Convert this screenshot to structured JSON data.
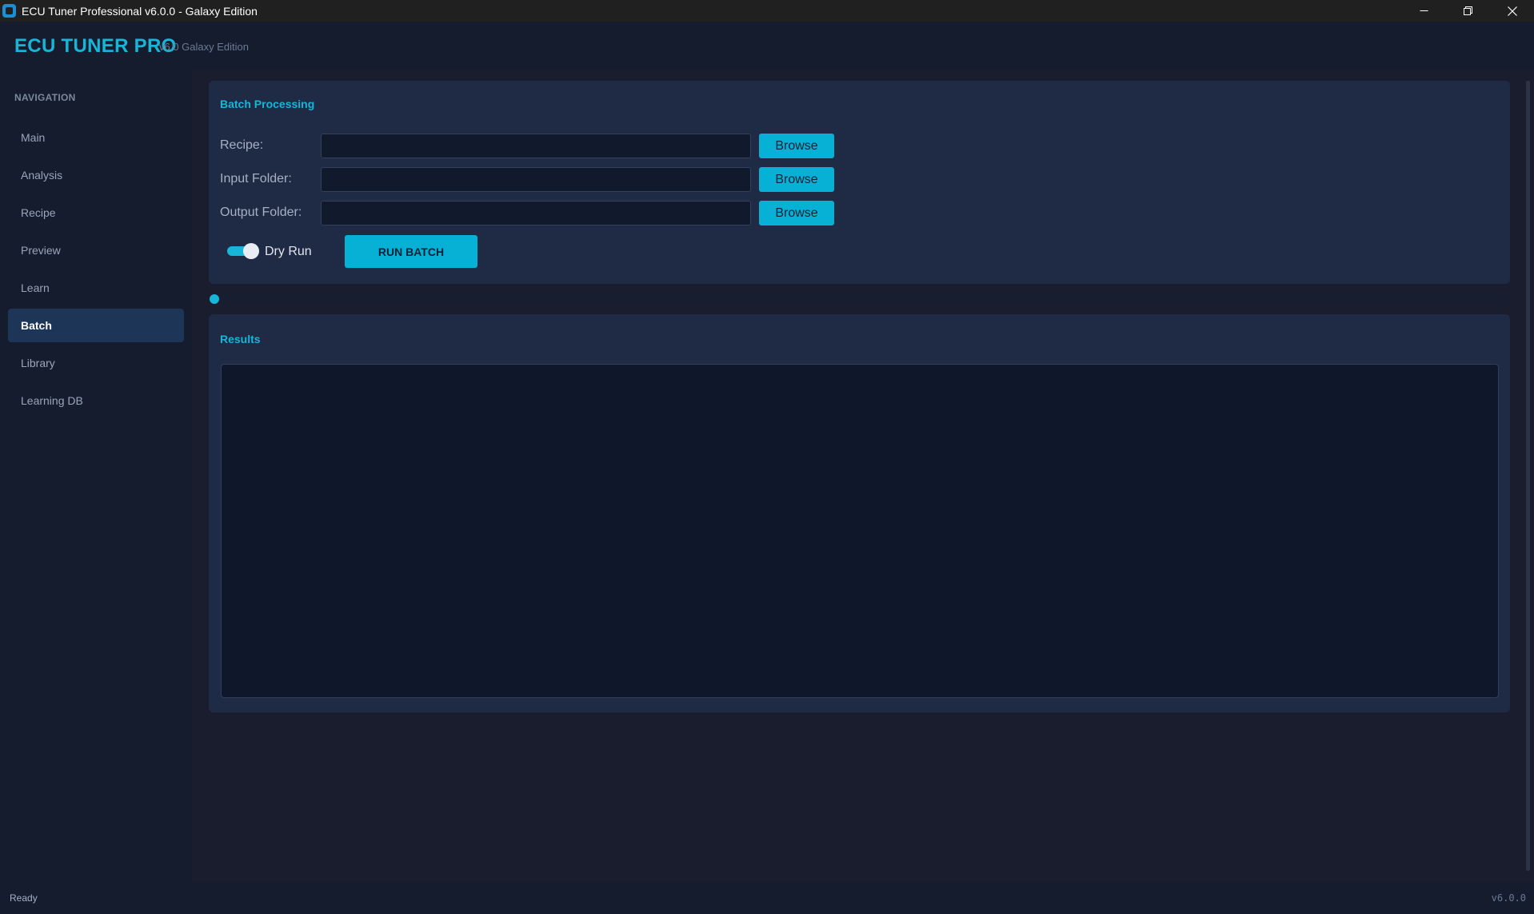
{
  "window": {
    "title": "ECU Tuner Professional v6.0.0 - Galaxy Edition",
    "minimize_glyph": "—",
    "maximize_glyph": "❐",
    "close_glyph": "✕"
  },
  "header": {
    "brand": "ECU TUNER PRO",
    "subtitle": "v6.0 Galaxy Edition"
  },
  "sidebar": {
    "heading": "NAVIGATION",
    "items": [
      {
        "label": "Main"
      },
      {
        "label": "Analysis"
      },
      {
        "label": "Recipe"
      },
      {
        "label": "Preview"
      },
      {
        "label": "Learn"
      },
      {
        "label": "Batch",
        "active": true
      },
      {
        "label": "Library"
      },
      {
        "label": "Learning DB"
      }
    ]
  },
  "batch": {
    "title": "Batch Processing",
    "recipe": {
      "label": "Recipe:",
      "value": "",
      "browse_label": "Browse"
    },
    "input_folder": {
      "label": "Input Folder:",
      "value": "",
      "browse_label": "Browse"
    },
    "output_folder": {
      "label": "Output Folder:",
      "value": "",
      "browse_label": "Browse"
    },
    "dry_run": {
      "label": "Dry Run",
      "checked": true
    },
    "run_label": "RUN BATCH"
  },
  "progress": {
    "value": 0
  },
  "results": {
    "title": "Results",
    "content": ""
  },
  "status": {
    "text": "Ready",
    "version": "v6.0.0"
  },
  "colors": {
    "accent": "#17b6d9",
    "button": "#07b1d6",
    "active_nav": "#1d3557",
    "panel": "#1f2a44",
    "background": "#1a1d2e"
  }
}
